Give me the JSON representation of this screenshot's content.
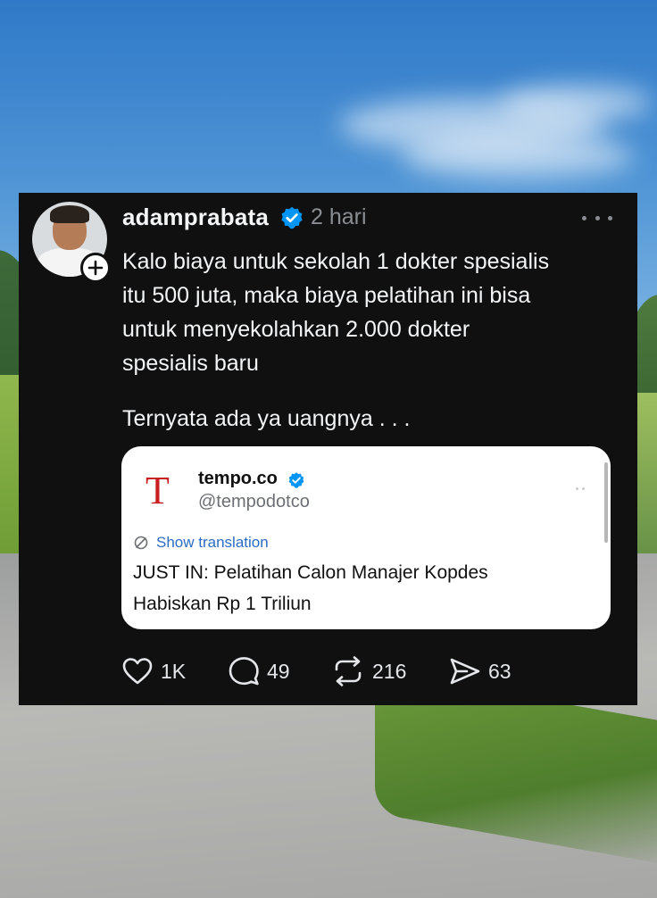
{
  "post": {
    "username": "adamprabata",
    "time": "2 hari",
    "text_lines": [
      "Kalo biaya untuk sekolah 1 dokter spesialis",
      "itu 500 juta, maka biaya pelatihan ini bisa",
      "untuk menyekolahkan 2.000 dokter",
      "spesialis baru"
    ],
    "text_second": "Ternyata ada ya uangnya . . ."
  },
  "quote": {
    "logo_letter": "T",
    "name": "tempo.co",
    "handle": "@tempodotco",
    "show_translation": "Show translation",
    "text_lines": [
      "JUST IN: Pelatihan Calon Manajer Kopdes",
      "Habiskan Rp 1 Triliun"
    ]
  },
  "actions": {
    "likes": "1K",
    "replies": "49",
    "reposts": "216",
    "shares": "63"
  },
  "icons": [
    "verified-icon",
    "more-options-icon",
    "follow-plus-icon",
    "translate-icon",
    "heart-icon",
    "reply-icon",
    "repost-icon",
    "share-icon"
  ],
  "colors": {
    "card_background": "#101010",
    "verified_blue": "#0095f6",
    "logo_red": "#c81e1e",
    "link_blue": "#2b6cc4"
  }
}
